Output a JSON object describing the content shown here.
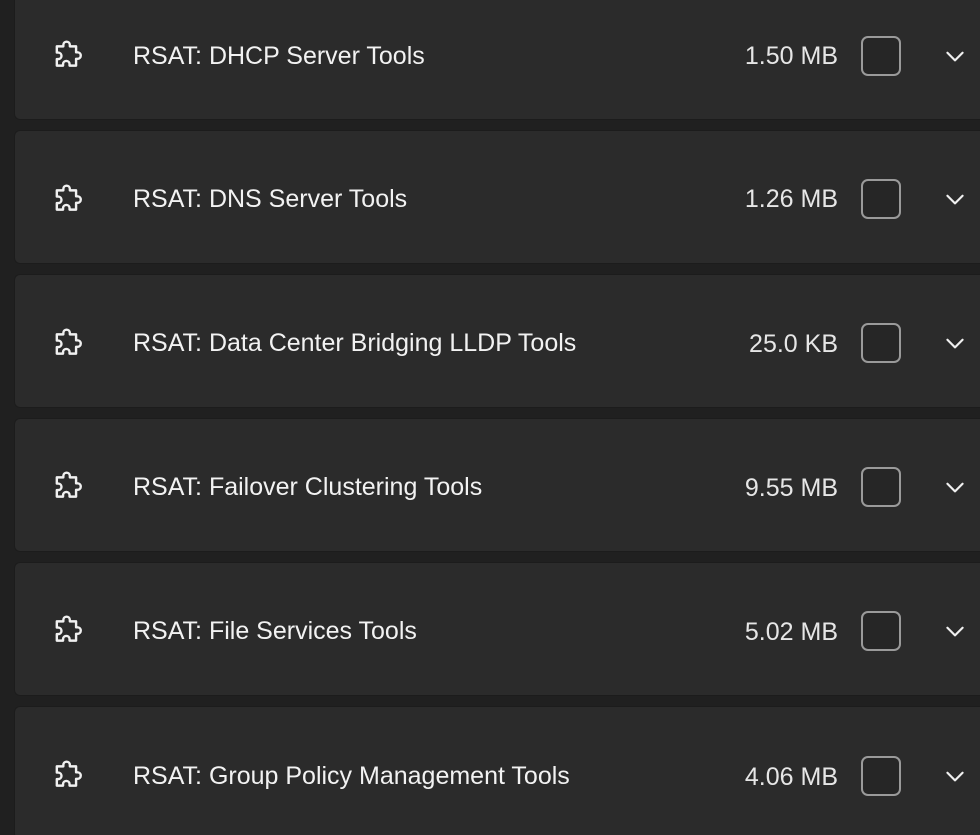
{
  "features": [
    {
      "name": "RSAT: DHCP Server Tools",
      "size": "1.50 MB",
      "checked": false,
      "icon": "puzzle-icon"
    },
    {
      "name": "RSAT: DNS Server Tools",
      "size": "1.26 MB",
      "checked": false,
      "icon": "puzzle-icon"
    },
    {
      "name": "RSAT: Data Center Bridging LLDP Tools",
      "size": "25.0 KB",
      "checked": false,
      "icon": "puzzle-icon"
    },
    {
      "name": "RSAT: Failover Clustering Tools",
      "size": "9.55 MB",
      "checked": false,
      "icon": "puzzle-icon"
    },
    {
      "name": "RSAT: File Services Tools",
      "size": "5.02 MB",
      "checked": false,
      "icon": "puzzle-icon"
    },
    {
      "name": "RSAT: Group Policy Management Tools",
      "size": "4.06 MB",
      "checked": false,
      "icon": "puzzle-icon"
    }
  ],
  "colors": {
    "background": "#202020",
    "card": "#2b2b2b",
    "text": "#f2f2f2",
    "checkbox_border": "#9a9a9a"
  }
}
